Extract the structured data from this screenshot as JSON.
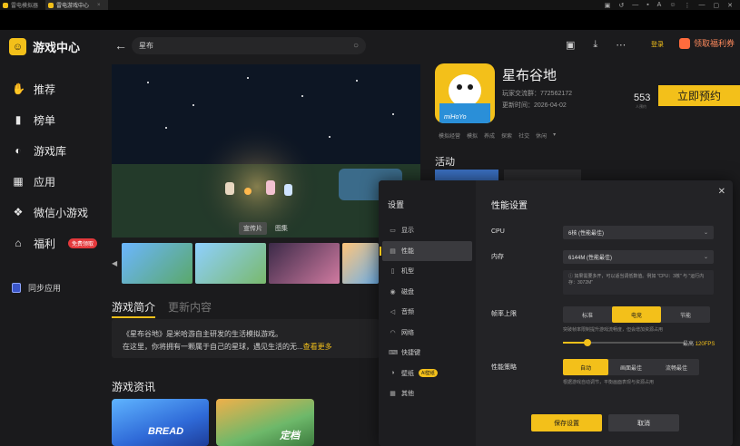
{
  "titlebar": {
    "tabs": [
      {
        "label": "雷电模拟器",
        "active": false
      },
      {
        "label": "雷电游戏中心",
        "active": true
      }
    ],
    "system_icons": [
      "▣",
      "↺",
      "—",
      "▪",
      "A",
      "☺",
      "⋮",
      "—",
      "▢",
      "✕"
    ]
  },
  "sidebar": {
    "brand": "游戏中心",
    "items": [
      {
        "icon": "✋",
        "label": "推荐"
      },
      {
        "icon": "▮",
        "label": "榜单"
      },
      {
        "icon": "◐",
        "label": "游戏库"
      },
      {
        "icon": "▦",
        "label": "应用"
      },
      {
        "icon": "❖",
        "label": "微信小游戏"
      },
      {
        "icon": "⌂",
        "label": "福利",
        "badge": "免费领取"
      }
    ],
    "sync": "同步应用"
  },
  "header": {
    "search_value": "星布",
    "login": "登录",
    "welfare": "领取福利券"
  },
  "hero": {
    "tabs": [
      "宣传片",
      "图集"
    ]
  },
  "content_tabs": {
    "intro": "游戏简介",
    "news": "更新内容"
  },
  "intro": {
    "line1": "《星布谷地》是米哈游自主研发的生活模拟游戏。",
    "line2": "在这里，你将拥有一颗属于自己的星球，遇见生活的无...",
    "more": "查看更多"
  },
  "news": {
    "title": "游戏资讯",
    "caption1": "BREAD",
    "caption2": "定档"
  },
  "game": {
    "name": "星布谷地",
    "qq_group": "玩家交流群：772562172",
    "update_date": "更新时间：2026-04-02",
    "fans": "553",
    "fans_label": "人预约",
    "reserve": "立即预约",
    "tags": [
      "模拟经营",
      "模拟",
      "养成",
      "探索",
      "社交",
      "休闲"
    ],
    "activity": "活动",
    "icon_watermark": "miHoYo"
  },
  "settings": {
    "title": "设置",
    "nav": [
      {
        "icon": "▭",
        "label": "显示"
      },
      {
        "icon": "▤",
        "label": "性能"
      },
      {
        "icon": "▯",
        "label": "机型"
      },
      {
        "icon": "◉",
        "label": "磁盘"
      },
      {
        "icon": "◁",
        "label": "音频"
      },
      {
        "icon": "◠",
        "label": "网络"
      },
      {
        "icon": "⌨",
        "label": "快捷键"
      },
      {
        "icon": "◑",
        "label": "壁纸",
        "badge": "AI壁纸"
      },
      {
        "icon": "▦",
        "label": "其他"
      }
    ],
    "panel_title": "性能设置",
    "cpu_label": "CPU",
    "cpu_value": "6核 (性能最佳)",
    "mem_label": "内存",
    "mem_value": "6144M (性能最佳)",
    "hint": "如果需要多开，可以适当调低数值。例如 \"CPU：3核\" 与 \"运行内存：3072M\"",
    "fps_label": "帧率上限",
    "fps_options": [
      "标准",
      "电竞",
      "节能"
    ],
    "fps_selected": 1,
    "fps_note": "突破帧率限制提升游戏流畅度，但会增加资源占用",
    "fps_max_label": "最高",
    "fps_value": "120FPS",
    "fps_slider_fraction": 0.2,
    "strategy_label": "性能策略",
    "strategy_options": [
      "自动",
      "画面最佳",
      "流畅最佳"
    ],
    "strategy_selected": 0,
    "strategy_note": "根据游戏自动调节，平衡画面表现与资源占用",
    "save": "保存设置",
    "cancel": "取消",
    "close": "✕"
  },
  "colors": {
    "accent": "#f3c01a",
    "background": "#1b1b1d",
    "dialog": "#232326"
  }
}
